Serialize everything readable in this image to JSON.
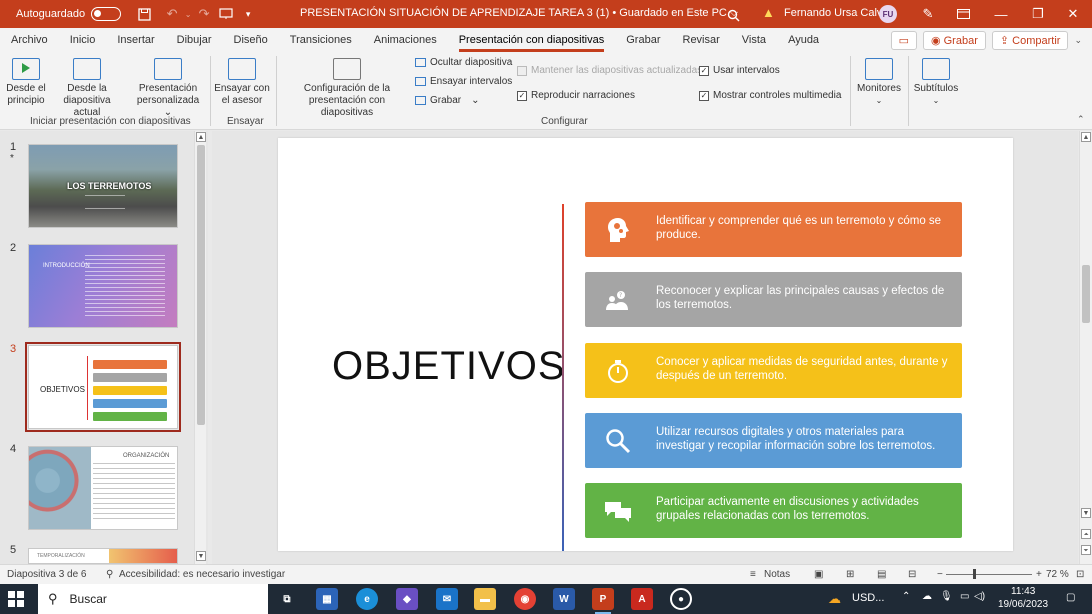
{
  "titlebar": {
    "autosave_label": "Autoguardado",
    "doc_title": "PRESENTACIÓN SITUACIÓN DE APRENDIZAJE TAREA 3 (1) • Guardado en Este PC ⌵",
    "user_name": "Fernando Ursa Calvo",
    "user_initials": "FU"
  },
  "menu": {
    "tabs": [
      "Archivo",
      "Inicio",
      "Insertar",
      "Dibujar",
      "Diseño",
      "Transiciones",
      "Animaciones",
      "Presentación con diapositivas",
      "Grabar",
      "Revisar",
      "Vista",
      "Ayuda"
    ],
    "active_tab": "Presentación con diapositivas",
    "record_button": "Grabar",
    "share_button": "Compartir"
  },
  "ribbon": {
    "from_start": "Desde el principio",
    "from_current": "Desde la diapositiva actual",
    "custom": "Presentación personalizada ⌄",
    "group_start": "Iniciar presentación con diapositivas",
    "rehearse_coach": "Ensayar con el asesor",
    "group_rehearse": "Ensayar",
    "setup": "Configuración de la presentación con diapositivas",
    "hide_slide": "Ocultar diapositiva",
    "rehearse_timings": "Ensayar intervalos",
    "record": "Grabar",
    "keep_updated": "Mantener las diapositivas actualizadas",
    "play_narrations": "Reproducir narraciones",
    "use_timings": "Usar intervalos",
    "show_media_controls": "Mostrar controles multimedia",
    "group_setup": "Configurar",
    "monitors": "Monitores",
    "subtitles": "Subtítulos"
  },
  "thumbnails": {
    "numbers": [
      "1",
      "2",
      "3",
      "4",
      "5"
    ],
    "slide1_title": "LOS TERREMOTOS",
    "slide2_title": "INTRODUCCIÓN",
    "slide3_title": "OBJETIVOS",
    "slide4_title": "ORGANIZACIÓN",
    "slide5_title": "TEMPORALIZACIÓN"
  },
  "slide": {
    "title": "OBJETIVOS",
    "objectives": [
      {
        "text": "Identificar y comprender qué es un terremoto y cómo se produce.",
        "color": "#e8743b",
        "icon": "head-gears-icon"
      },
      {
        "text": "Reconocer y explicar las principales causas y efectos de los terremotos.",
        "color": "#a5a5a5",
        "icon": "people-question-icon"
      },
      {
        "text": "Conocer y aplicar medidas de seguridad antes, durante y después de un terremoto.",
        "color": "#f5c119",
        "icon": "stopwatch-icon"
      },
      {
        "text": "Utilizar recursos digitales y otros materiales para investigar y recopilar información sobre los terremotos.",
        "color": "#5b9bd5",
        "icon": "magnifier-icon"
      },
      {
        "text": "Participar activamente en discusiones y actividades grupales relacionadas con los terremotos.",
        "color": "#62b346",
        "icon": "chat-bubbles-icon"
      }
    ]
  },
  "status": {
    "slide_counter": "Diapositiva 3 de 6",
    "accessibility": "Accesibilidad: es necesario investigar",
    "notes": "Notas",
    "zoom": "72 %"
  },
  "taskbar": {
    "search_placeholder": "Buscar",
    "currency": "USD...",
    "time": "11:43",
    "date": "19/06/2023"
  }
}
